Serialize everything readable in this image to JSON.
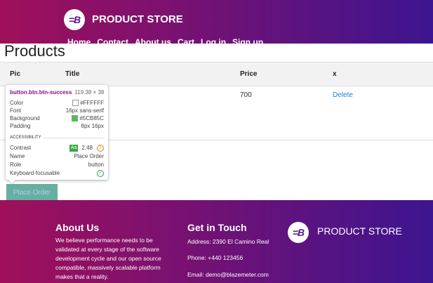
{
  "header": {
    "brand": "PRODUCT STORE",
    "logo_text": "=B",
    "nav": [
      "Home",
      "Contact",
      "About us",
      "Cart",
      "Log in",
      "Sign up"
    ]
  },
  "page_title": "Products",
  "table": {
    "columns": [
      "Pic",
      "Title",
      "Price",
      "x"
    ],
    "rows": [
      {
        "price": "700",
        "action": "Delete"
      }
    ]
  },
  "inspector": {
    "selector": "button.btn.btn-success",
    "size": "119.38 × 38",
    "rows": [
      {
        "key": "Color",
        "value": "#FFFFFF",
        "swatch": "#FFFFFF"
      },
      {
        "key": "Font",
        "value": "16px sans-serif"
      },
      {
        "key": "Background",
        "value": "#5CB85C",
        "swatch": "#5CB85C"
      },
      {
        "key": "Padding",
        "value": "8px 16px"
      }
    ],
    "accessibility_label": "ACCESSIBILITY",
    "contrast_label": "Contrast",
    "contrast_badge": "Aa",
    "contrast_value": "2.48",
    "name_label": "Name",
    "name_value": "Place Order",
    "role_label": "Role",
    "role_value": "button",
    "focusable_label": "Keyboard-focusable"
  },
  "place_order_label": "Place Order",
  "footer": {
    "about_title": "About Us",
    "about_text": "We believe performance needs to be validated at every stage of the software development cycle and our open source compatible, massively scalable platform makes that a reality.",
    "contact_title": "Get in Touch",
    "address": "Address: 2390 El Camino Real",
    "phone": "Phone: +440 123456",
    "email": "Email: demo@blazemeter.com",
    "brand": "PRODUCT STORE"
  },
  "colors": {
    "header_start": "#a0105a",
    "header_end": "#3c1590",
    "success_button": "#5cb85c",
    "link": "#1e7fd6"
  }
}
